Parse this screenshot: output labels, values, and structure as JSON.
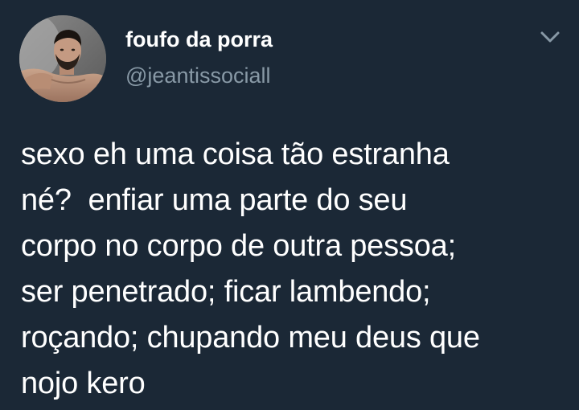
{
  "tweet": {
    "display_name": "foufo da porra",
    "handle": "@jeantissociall",
    "text": "sexo eh uma coisa tão estranha\nné?  enfiar uma parte do seu\ncorpo no corpo de outra pessoa;\nser penetrado; ficar lambendo;\nroçando; chupando meu deus que\nnojo kero",
    "more_icon": "chevron-down-icon",
    "avatar": "user-avatar"
  },
  "colors": {
    "background": "#1b2836",
    "text": "#ffffff",
    "secondary_text": "#8899a6"
  }
}
